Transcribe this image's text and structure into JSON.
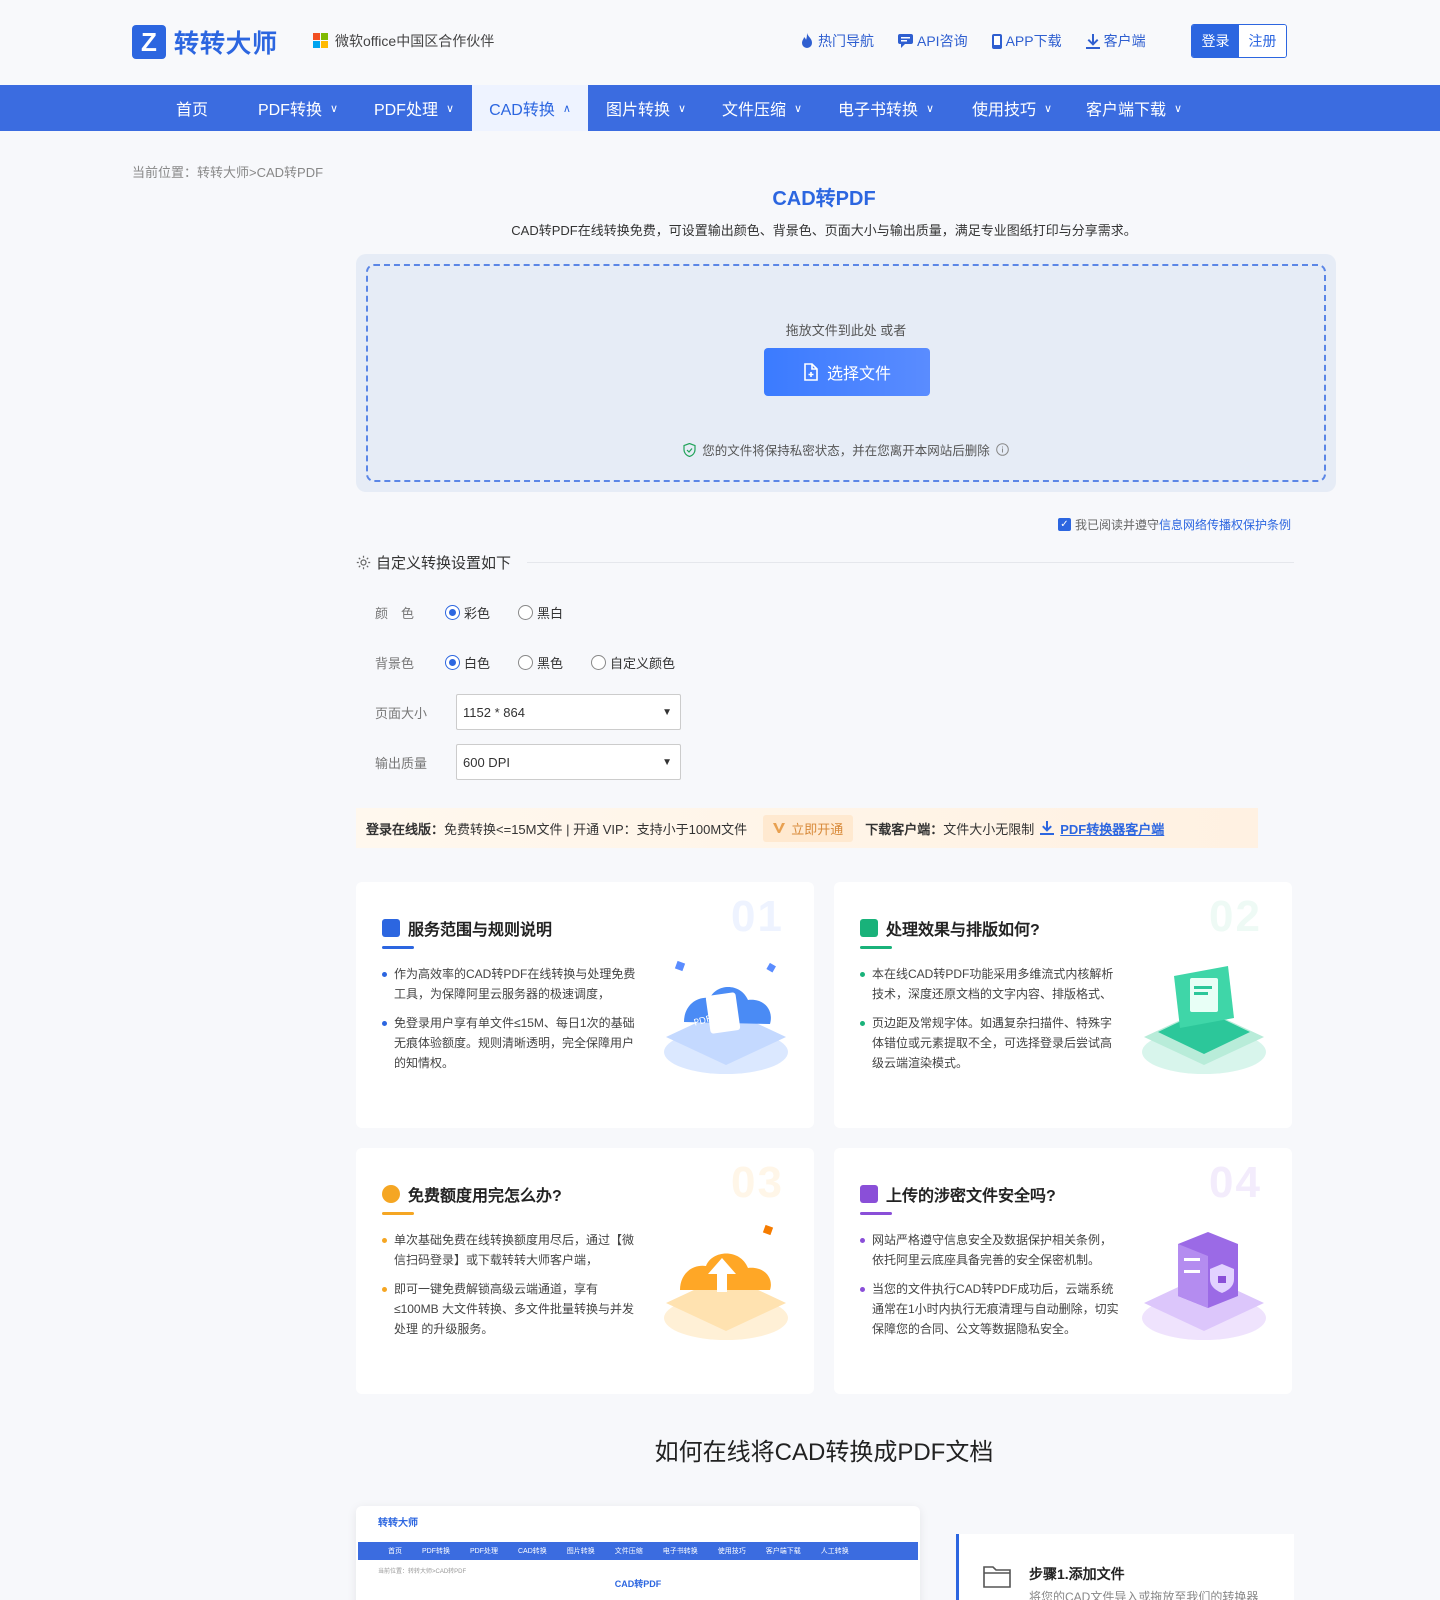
{
  "header": {
    "logo_mark": "Z",
    "logo_text": "转转大师",
    "partner": "微软office中国区合作伙伴",
    "links": [
      "热门导航",
      "API咨询",
      "APP下载",
      "客户端"
    ],
    "login": "登录",
    "register": "注册"
  },
  "nav": {
    "items": [
      {
        "label": "首页",
        "chevron": ""
      },
      {
        "label": "PDF转换",
        "chevron": "∨"
      },
      {
        "label": "PDF处理",
        "chevron": "∨"
      },
      {
        "label": "CAD转换",
        "chevron": "∧"
      },
      {
        "label": "图片转换",
        "chevron": "∨"
      },
      {
        "label": "文件压缩",
        "chevron": "∨"
      },
      {
        "label": "电子书转换",
        "chevron": "∨"
      },
      {
        "label": "使用技巧",
        "chevron": "∨"
      },
      {
        "label": "客户端下载",
        "chevron": "∨"
      }
    ]
  },
  "breadcrumb": "当前位置：转转大师>CAD转PDF",
  "page": {
    "title": "CAD转PDF",
    "desc": "CAD转PDF在线转换免费，可设置输出颜色、背景色、页面大小与输出质量，满足专业图纸打印与分享需求。"
  },
  "upload": {
    "drop_text": "拖放文件到此处 或者",
    "choose_label": "选择文件",
    "privacy": "您的文件将保持私密状态，并在您离开本网站后删除"
  },
  "agree": {
    "text": "我已阅读并遵守",
    "link": "信息网络传播权保护条例"
  },
  "settings": {
    "heading": "自定义转换设置如下",
    "color_label": "颜　色",
    "color_options": [
      "彩色",
      "黑白"
    ],
    "bg_label": "背景色",
    "bg_options": [
      "白色",
      "黑色",
      "自定义颜色"
    ],
    "size_label": "页面大小",
    "size_value": "1152 * 864",
    "quality_label": "输出质量",
    "quality_value": "600 DPI"
  },
  "infobar": {
    "online_label": "登录在线版：",
    "online_text": "免费转换<=15M文件 | 开通 VIP：支持小于100M文件",
    "vip_btn": "立即开通",
    "client_label": "下载客户端：",
    "client_text": "文件大小无限制",
    "client_link": "PDF转换器客户端"
  },
  "cards": [
    {
      "num": "01",
      "title": "服务范围与规则说明",
      "bullets": [
        "作为高效率的CAD转PDF在线转换与处理免费工具，为保障阿里云服务器的极速调度，",
        "免登录用户享有单文件≤15M、每日1次的基础无痕体验额度。规则清晰透明，完全保障用户的知情权。"
      ]
    },
    {
      "num": "02",
      "title": "处理效果与排版如何?",
      "bullets": [
        "本在线CAD转PDF功能采用多维流式内核解析技术，深度还原文档的文字内容、排版格式、",
        "页边距及常规字体。如遇复杂扫描件、特殊字体错位或元素提取不全，可选择登录后尝试高级云端渲染模式。"
      ]
    },
    {
      "num": "03",
      "title": "免费额度用完怎么办?",
      "bullets": [
        "单次基础免费在线转换额度用尽后，通过【微信扫码登录】或下载转转大师客户端，",
        "即可一键免费解锁高级云端通道，享有≤100MB 大文件转换、多文件批量转换与并发处理 的升级服务。"
      ]
    },
    {
      "num": "04",
      "title": "上传的涉密文件安全吗?",
      "bullets": [
        "网站严格遵守信息安全及数据保护相关条例，依托阿里云底座具备完善的安全保密机制。",
        "当您的文件执行CAD转PDF成功后，云端系统通常在1小时内执行无痕清理与自动删除，切实保障您的合同、公文等数据隐私安全。"
      ]
    }
  ],
  "how": {
    "title": "如何在线将CAD转换成PDF文档",
    "shot_logo": "转转大师",
    "shot_nav": [
      "首页",
      "PDF转换",
      "PDF处理",
      "CAD转换",
      "图片转换",
      "文件压缩",
      "电子书转换",
      "使用技巧",
      "客户端下载",
      "人工转换"
    ],
    "shot_bc": "当前位置：转转大师>CAD转PDF",
    "shot_title": "CAD转PDF",
    "step_title": "步骤1.添加文件",
    "step_desc": "将您的CAD文件导入或拖放至我们的转换器"
  },
  "colors": {
    "primary": "#2c66e0",
    "nav": "#3b6ce0",
    "card_blue": "#2c66e0",
    "card_green": "#19b27a",
    "card_orange": "#f5a623",
    "card_purple": "#8a4fd8"
  }
}
